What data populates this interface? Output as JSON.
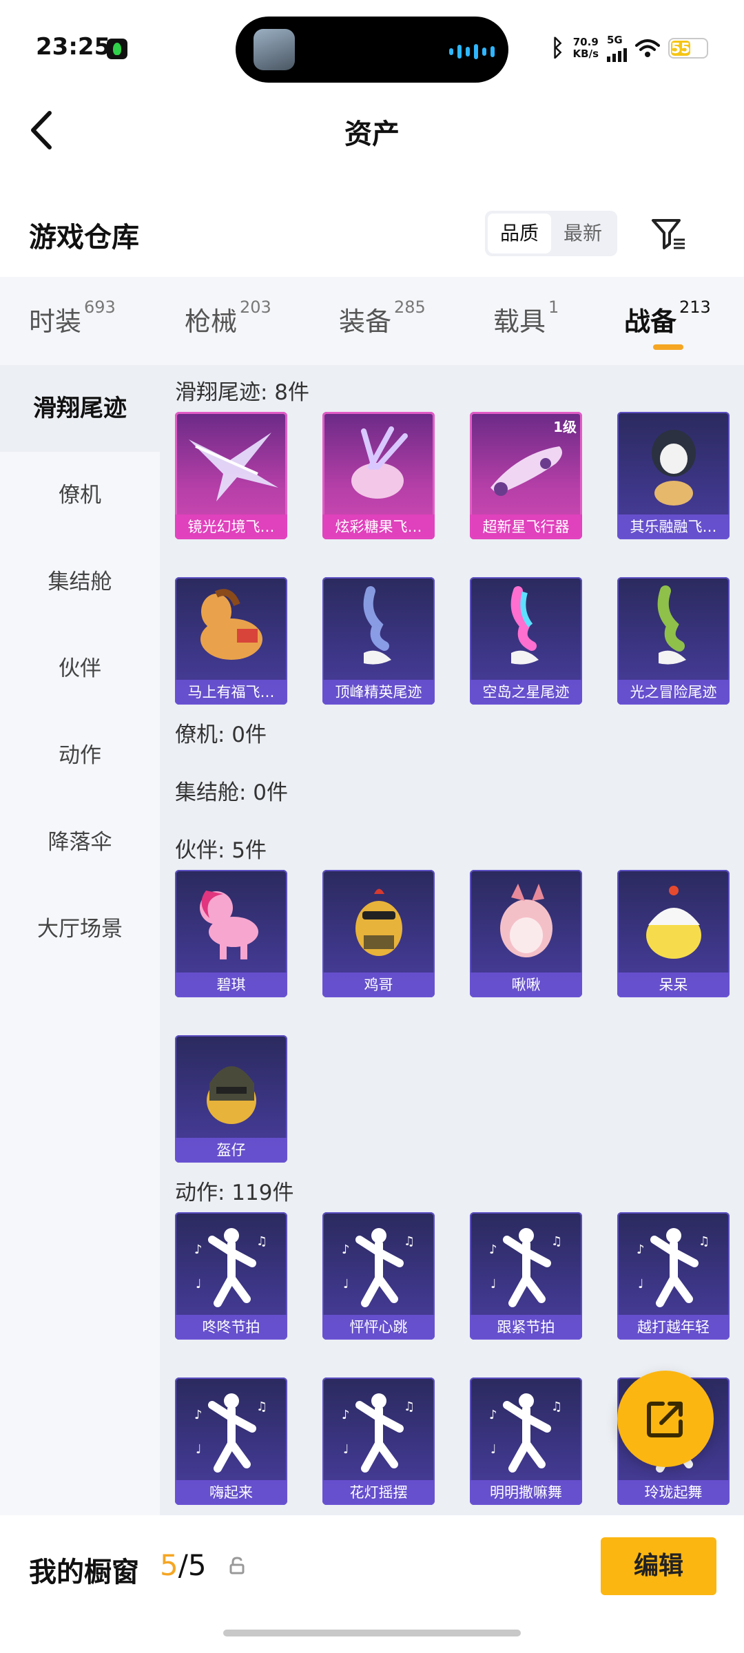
{
  "status_bar": {
    "time": "23:25",
    "net_speed_value": "70.9",
    "net_speed_unit": "KB/s",
    "signal_type": "5G",
    "battery": "55"
  },
  "header": {
    "title": "资产"
  },
  "warehouse": {
    "title": "游戏仓库",
    "sort_options": [
      "品质",
      "最新"
    ],
    "sort_selected": "品质"
  },
  "tabs": [
    {
      "label": "时装",
      "count": "693"
    },
    {
      "label": "枪械",
      "count": "203"
    },
    {
      "label": "装备",
      "count": "285"
    },
    {
      "label": "载具",
      "count": "1"
    },
    {
      "label": "战备",
      "count": "213",
      "active": true
    }
  ],
  "sidebar": {
    "items": [
      {
        "label": "滑翔尾迹",
        "active": true
      },
      {
        "label": "僚机"
      },
      {
        "label": "集结舱"
      },
      {
        "label": "伙伴"
      },
      {
        "label": "动作"
      },
      {
        "label": "降落伞"
      },
      {
        "label": "大厅场景"
      }
    ]
  },
  "sections": [
    {
      "title": "滑翔尾迹: 8件",
      "items": [
        {
          "name": "镜光幻境飞…",
          "style": "pink",
          "icon": "wings-icon"
        },
        {
          "name": "炫彩糖果飞…",
          "style": "pink",
          "icon": "candy-icon"
        },
        {
          "name": "超新星飞行器",
          "style": "pink",
          "icon": "aircraft-icon",
          "badge": "1级"
        },
        {
          "name": "其乐融融飞…",
          "style": "blue",
          "icon": "penguin-icon"
        },
        {
          "name": "马上有福飞…",
          "style": "blue",
          "icon": "horse-icon"
        },
        {
          "name": "顶峰精英尾迹",
          "style": "blue",
          "icon": "smoke-trail-icon"
        },
        {
          "name": "空岛之星尾迹",
          "style": "blue",
          "icon": "rainbow-trail-icon"
        },
        {
          "name": "光之冒险尾迹",
          "style": "blue",
          "icon": "green-trail-icon"
        }
      ]
    },
    {
      "title": "僚机: 0件",
      "items": []
    },
    {
      "title": "集结舱: 0件",
      "items": []
    },
    {
      "title": "伙伴: 5件",
      "items": [
        {
          "name": "碧琪",
          "style": "blue",
          "icon": "pony-icon"
        },
        {
          "name": "鸡哥",
          "style": "blue",
          "icon": "chicken-icon"
        },
        {
          "name": "啾啾",
          "style": "blue",
          "icon": "bird-icon"
        },
        {
          "name": "呆呆",
          "style": "blue",
          "icon": "chick-icon"
        },
        {
          "name": "盔仔",
          "style": "blue",
          "icon": "helmet-chick-icon"
        }
      ]
    },
    {
      "title": "动作: 119件",
      "items": [
        {
          "name": "咚咚节拍",
          "style": "blue",
          "icon": "dance-icon"
        },
        {
          "name": "怦怦心跳",
          "style": "blue",
          "icon": "dance-icon"
        },
        {
          "name": "跟紧节拍",
          "style": "blue",
          "icon": "dance-icon"
        },
        {
          "name": "越打越年轻",
          "style": "blue",
          "icon": "dance-icon"
        },
        {
          "name": "嗨起来",
          "style": "blue",
          "icon": "dance-icon"
        },
        {
          "name": "花灯摇摆",
          "style": "blue",
          "icon": "dance-icon"
        },
        {
          "name": "明明撒嘛舞",
          "style": "blue",
          "icon": "dance-icon"
        },
        {
          "name": "玲珑起舞",
          "style": "blue",
          "icon": "dance-icon"
        }
      ]
    }
  ],
  "bottom_bar": {
    "title": "我的橱窗",
    "current": "5",
    "separator": "/",
    "total": "5",
    "edit_label": "编辑"
  },
  "colors": {
    "accent": "#fbb612",
    "pink_card": "#d34bb5",
    "blue_card": "#3d3687"
  }
}
